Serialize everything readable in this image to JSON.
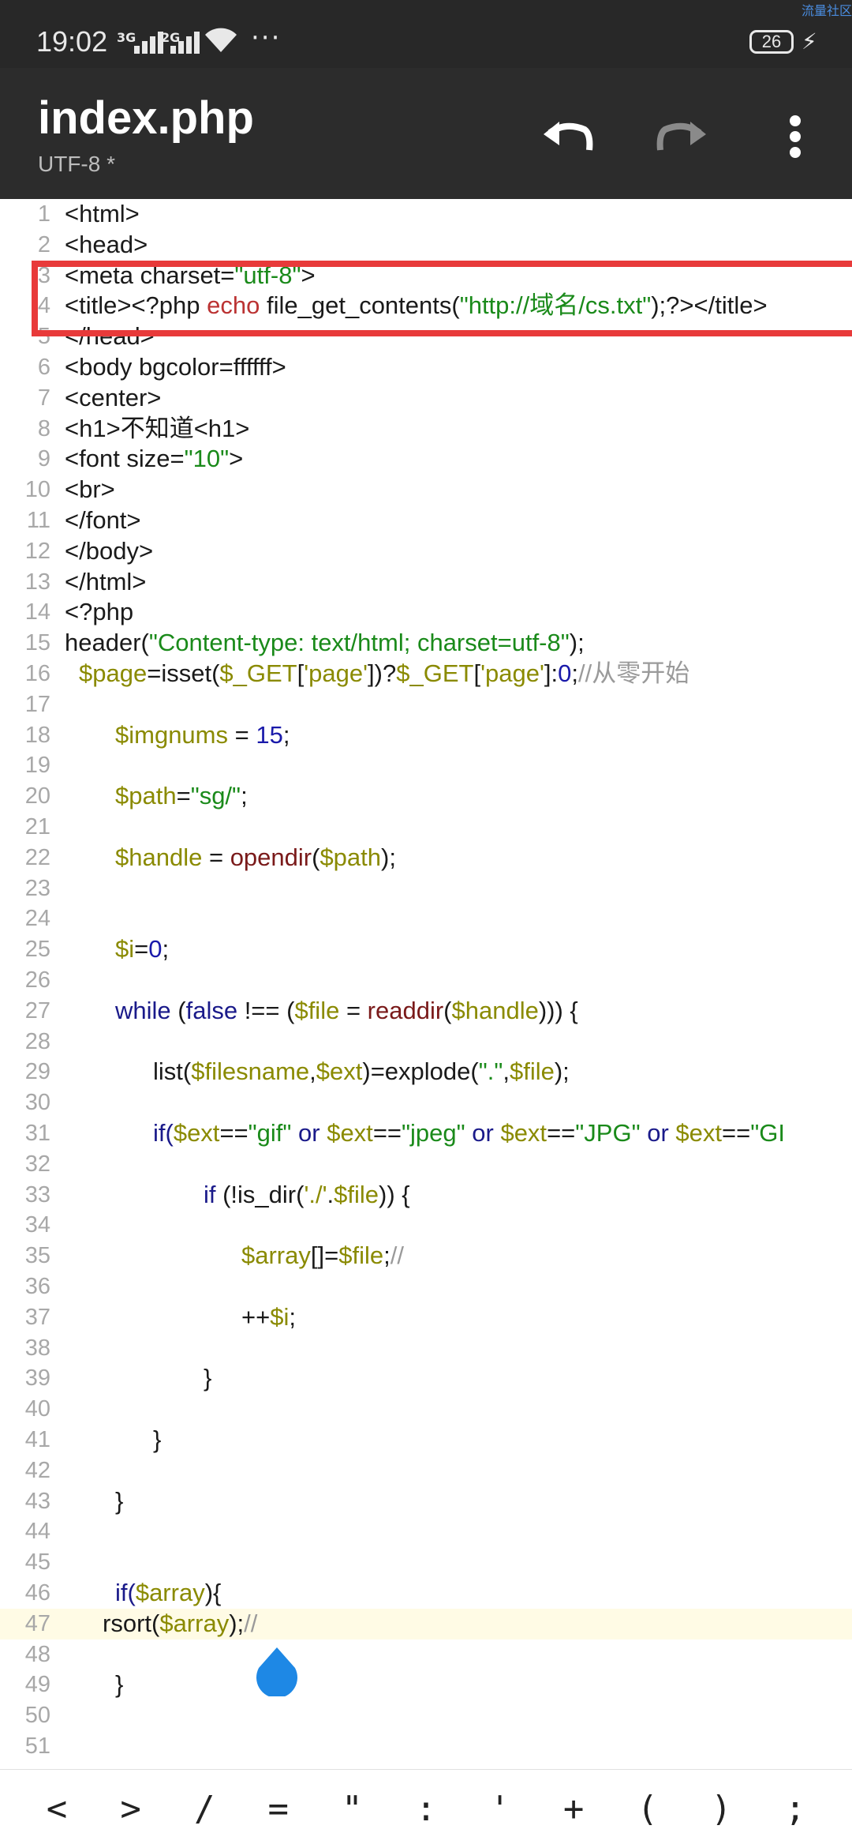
{
  "status_bar": {
    "time": "19:02",
    "signal_1_label": "3G",
    "signal_2_label": "2G",
    "more": "···",
    "battery": "26",
    "corner_text": "流量社区"
  },
  "app_bar": {
    "title": "index.php",
    "subtitle": "UTF-8 *",
    "icons": [
      "undo-icon",
      "redo-icon",
      "more-vert-icon"
    ]
  },
  "editor": {
    "line_numbers": [
      "1",
      "2",
      "3",
      "4",
      "5",
      "6",
      "7",
      "8",
      "9",
      "10",
      "11",
      "12",
      "13",
      "14",
      "15",
      "16",
      "17",
      "18",
      "19",
      "20",
      "21",
      "22",
      "23",
      "24",
      "25",
      "26",
      "27",
      "28",
      "29",
      "30",
      "31",
      "32",
      "33",
      "34",
      "35",
      "36",
      "37",
      "38",
      "39",
      "40",
      "41",
      "42",
      "43",
      "44",
      "45",
      "46",
      "47",
      "48",
      "49",
      "50",
      "51"
    ],
    "lines": {
      "l1": "<html>",
      "l2": "<head>",
      "l3a": "<meta charset=",
      "l3b": "\"utf-8\"",
      "l3c": ">",
      "l4a": "<title><?php ",
      "l4b": "echo",
      "l4c": " file_get_contents(",
      "l4d": "\"http://域名/cs.txt\"",
      "l4e": ");?></title>",
      "l5": "</head>",
      "l6": "<body bgcolor=ffffff>",
      "l7": "<center>",
      "l8": "<h1>不知道<h1>",
      "l9a": "<font size=",
      "l9b": "\"10\"",
      "l9c": ">",
      "l10": "<br>",
      "l11": "</font>",
      "l12": "</body>",
      "l13": "</html>",
      "l14": "<?php",
      "l15a": "header(",
      "l15b": "\"Content-type: text/html; charset=utf-8\"",
      "l15c": ");",
      "l16a": "$page",
      "l16b": "=isset(",
      "l16c": "$_GET",
      "l16d": "[",
      "l16e": "'page'",
      "l16f": "])?",
      "l16g": "$_GET",
      "l16h": "[",
      "l16i": "'page'",
      "l16j": "]:",
      "l16k": "0",
      "l16l": ";",
      "l16m": "//从零开始",
      "l18a": "$imgnums",
      "l18b": " = ",
      "l18c": "15",
      "l18d": ";",
      "l20a": "$path",
      "l20b": "=",
      "l20c": "\"sg/\"",
      "l20d": ";",
      "l22a": "$handle",
      "l22b": " = ",
      "l22c": "opendir",
      "l22d": "(",
      "l22e": "$path",
      "l22f": ");",
      "l25a": "$i",
      "l25b": "=",
      "l25c": "0",
      "l25d": ";",
      "l27a": "while",
      "l27b": " (",
      "l27c": "false",
      "l27d": " !== (",
      "l27e": "$file",
      "l27f": " = ",
      "l27g": "readdir",
      "l27h": "(",
      "l27i": "$handle",
      "l27j": "))) {",
      "l29a": "list(",
      "l29b": "$filesname",
      "l29c": ",",
      "l29d": "$ext",
      "l29e": ")=explode(",
      "l29f": "\".\"",
      "l29g": ",",
      "l29h": "$file",
      "l29i": ");",
      "l31a": "if(",
      "l31b": "$ext",
      "l31c": "==",
      "l31d": "\"gif\"",
      "l31e": " or ",
      "l31f": "$ext",
      "l31g": "==",
      "l31h": "\"jpeg\"",
      "l31i": " or ",
      "l31j": "$ext",
      "l31k": "==",
      "l31l": "\"JPG\"",
      "l31m": " or ",
      "l31n": "$ext",
      "l31o": "==",
      "l31p": "\"GI",
      "l33a": "if",
      "l33b": " (!is_dir(",
      "l33c": "'./'",
      "l33d": ".",
      "l33e": "$file",
      "l33f": ")) {",
      "l35a": "$array",
      "l35b": "[]=",
      "l35c": "$file",
      "l35d": ";",
      "l35e": "//",
      "l37a": "++",
      "l37b": "$i",
      "l37c": ";",
      "l39": "}",
      "l41": "}",
      "l43": "}",
      "l46a": "if(",
      "l46b": "$array",
      "l46c": "){",
      "l47a": "rsort(",
      "l47b": "$array",
      "l47c": ");",
      "l47d": "//",
      "l49": "}"
    }
  },
  "keys": [
    "<",
    ">",
    "/",
    "=",
    "\"",
    ":",
    "'",
    "+",
    "(",
    ")",
    ";"
  ],
  "colors": {
    "status_bar": "#282828",
    "app_bar": "#2c2c2c",
    "highlight_box": "#e83a3a",
    "string": "#1a8a1a",
    "variable": "#8a8a00",
    "keyword": "#1a1a8a",
    "current_line": "#fffbe5",
    "cursor_handle": "#1e88e5"
  }
}
